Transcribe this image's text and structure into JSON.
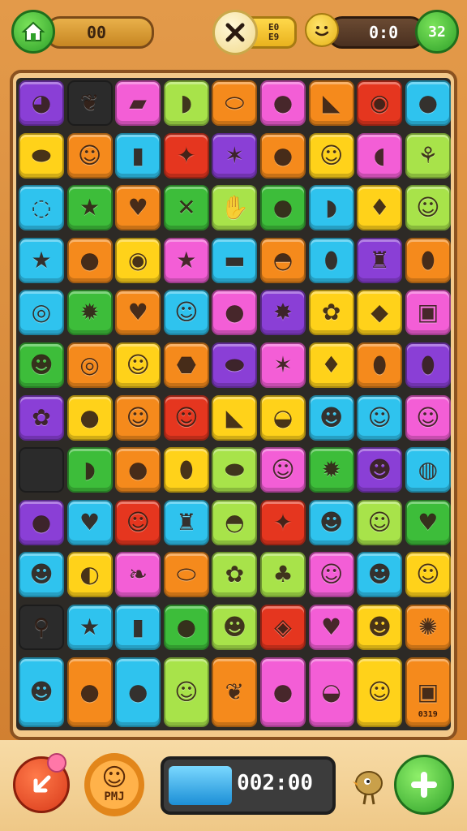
{
  "top_bar": {
    "home_icon": "house-icon",
    "left_counter": "00",
    "close_icon": "close-x-icon",
    "mid_badge": "E0\nE9",
    "smiley_icon": "smiley-icon",
    "right_counter": "0:0",
    "score": "32"
  },
  "board": {
    "colors": {
      "purple": "#8a3fd6",
      "dark": "#2b2b2b",
      "pink": "#f35ed6",
      "lime": "#a8e34a",
      "orange": "#f58a1c",
      "red": "#e5361f",
      "cyan": "#2fc3ee",
      "yellow": "#ffd21a",
      "green": "#3dbd3a",
      "magenta": "#d94fd9"
    },
    "tiles": [
      {
        "row": 0,
        "col": 0,
        "color": "purple",
        "icon": "ghost-icon",
        "glyph": "◕"
      },
      {
        "row": 0,
        "col": 1,
        "color": "dark",
        "icon": "leaf-icon",
        "glyph": "❦"
      },
      {
        "row": 0,
        "col": 2,
        "color": "pink",
        "icon": "flag-icon",
        "glyph": "▰"
      },
      {
        "row": 0,
        "col": 3,
        "color": "lime",
        "icon": "banana-icon",
        "glyph": "◗"
      },
      {
        "row": 0,
        "col": 4,
        "color": "orange",
        "icon": "lemon-icon",
        "glyph": "⬭"
      },
      {
        "row": 0,
        "col": 5,
        "color": "pink",
        "icon": "grape-icon",
        "glyph": "●"
      },
      {
        "row": 0,
        "col": 6,
        "color": "orange",
        "icon": "shoe-icon",
        "glyph": "◣"
      },
      {
        "row": 0,
        "col": 7,
        "color": "red",
        "icon": "speech-bubble-icon",
        "glyph": "◉"
      },
      {
        "row": 0,
        "col": 8,
        "color": "cyan",
        "icon": "apple-icon",
        "glyph": "●"
      },
      {
        "row": 1,
        "col": 0,
        "color": "yellow",
        "icon": "blob-icon",
        "glyph": "⬬"
      },
      {
        "row": 1,
        "col": 1,
        "color": "orange",
        "icon": "cat-face-icon",
        "glyph": "☺"
      },
      {
        "row": 1,
        "col": 2,
        "color": "cyan",
        "icon": "box-icon",
        "glyph": "▮"
      },
      {
        "row": 1,
        "col": 3,
        "color": "red",
        "icon": "star-burst-icon",
        "glyph": "✦"
      },
      {
        "row": 1,
        "col": 4,
        "color": "purple",
        "icon": "leaf-icon",
        "glyph": "✶"
      },
      {
        "row": 1,
        "col": 5,
        "color": "orange",
        "icon": "orange-fruit-icon",
        "glyph": "●"
      },
      {
        "row": 1,
        "col": 6,
        "color": "yellow",
        "icon": "face-icon",
        "glyph": "☺"
      },
      {
        "row": 1,
        "col": 7,
        "color": "pink",
        "icon": "blob-icon",
        "glyph": "◖"
      },
      {
        "row": 1,
        "col": 8,
        "color": "lime",
        "icon": "tulip-icon",
        "glyph": "⚘"
      },
      {
        "row": 2,
        "col": 0,
        "color": "cyan",
        "icon": "ring-icon",
        "glyph": "◌"
      },
      {
        "row": 2,
        "col": 1,
        "color": "green",
        "icon": "star-icon",
        "glyph": "★"
      },
      {
        "row": 2,
        "col": 2,
        "color": "orange",
        "icon": "heart-face-icon",
        "glyph": "♥"
      },
      {
        "row": 2,
        "col": 3,
        "color": "green",
        "icon": "fish-icon",
        "glyph": "✕"
      },
      {
        "row": 2,
        "col": 4,
        "color": "lime",
        "icon": "hand-icon",
        "glyph": "✋"
      },
      {
        "row": 2,
        "col": 5,
        "color": "green",
        "icon": "melon-icon",
        "glyph": "●"
      },
      {
        "row": 2,
        "col": 6,
        "color": "cyan",
        "icon": "eggplant-icon",
        "glyph": "◗"
      },
      {
        "row": 2,
        "col": 7,
        "color": "yellow",
        "icon": "strawberry-icon",
        "glyph": "♦"
      },
      {
        "row": 2,
        "col": 8,
        "color": "lime",
        "icon": "monster-face-icon",
        "glyph": "☺"
      },
      {
        "row": 3,
        "col": 0,
        "color": "cyan",
        "icon": "star-icon",
        "glyph": "★"
      },
      {
        "row": 3,
        "col": 1,
        "color": "orange",
        "icon": "apple-icon",
        "glyph": "●"
      },
      {
        "row": 3,
        "col": 2,
        "color": "yellow",
        "icon": "eye-icon",
        "glyph": "◉"
      },
      {
        "row": 3,
        "col": 3,
        "color": "pink",
        "icon": "star-icon",
        "glyph": "★"
      },
      {
        "row": 3,
        "col": 4,
        "color": "cyan",
        "icon": "flag-icon",
        "glyph": "▬"
      },
      {
        "row": 3,
        "col": 5,
        "color": "orange",
        "icon": "shell-icon",
        "glyph": "◓"
      },
      {
        "row": 3,
        "col": 6,
        "color": "cyan",
        "icon": "leaf-icon",
        "glyph": "⬮"
      },
      {
        "row": 3,
        "col": 7,
        "color": "purple",
        "icon": "bottle-icon",
        "glyph": "♜"
      },
      {
        "row": 3,
        "col": 8,
        "color": "orange",
        "icon": "pepper-icon",
        "glyph": "⬮"
      },
      {
        "row": 4,
        "col": 0,
        "color": "cyan",
        "icon": "swirl-icon",
        "glyph": "◎"
      },
      {
        "row": 4,
        "col": 1,
        "color": "green",
        "icon": "beetle-icon",
        "glyph": "✹"
      },
      {
        "row": 4,
        "col": 2,
        "color": "orange",
        "icon": "heart-icon",
        "glyph": "♥"
      },
      {
        "row": 4,
        "col": 3,
        "color": "cyan",
        "icon": "face-icon",
        "glyph": "☺"
      },
      {
        "row": 4,
        "col": 4,
        "color": "pink",
        "icon": "apple-icon",
        "glyph": "●"
      },
      {
        "row": 4,
        "col": 5,
        "color": "purple",
        "icon": "sparkle-icon",
        "glyph": "✸"
      },
      {
        "row": 4,
        "col": 6,
        "color": "yellow",
        "icon": "berry-icon",
        "glyph": "✿"
      },
      {
        "row": 4,
        "col": 7,
        "color": "yellow",
        "icon": "rock-icon",
        "glyph": "◆"
      },
      {
        "row": 4,
        "col": 8,
        "color": "pink",
        "icon": "robot-icon",
        "glyph": "▣"
      },
      {
        "row": 5,
        "col": 0,
        "color": "green",
        "icon": "blob-face-icon",
        "glyph": "☻"
      },
      {
        "row": 5,
        "col": 1,
        "color": "orange",
        "icon": "ring-icon",
        "glyph": "◎"
      },
      {
        "row": 5,
        "col": 2,
        "color": "yellow",
        "icon": "elf-face-icon",
        "glyph": "☺"
      },
      {
        "row": 5,
        "col": 3,
        "color": "orange",
        "icon": "blob-icon",
        "glyph": "⬣"
      },
      {
        "row": 5,
        "col": 4,
        "color": "purple",
        "icon": "drop-icon",
        "glyph": "⬬"
      },
      {
        "row": 5,
        "col": 5,
        "color": "pink",
        "icon": "star-icon",
        "glyph": "✶"
      },
      {
        "row": 5,
        "col": 6,
        "color": "yellow",
        "icon": "berry-icon",
        "glyph": "♦"
      },
      {
        "row": 5,
        "col": 7,
        "color": "orange",
        "icon": "leaf-icon",
        "glyph": "⬮"
      },
      {
        "row": 5,
        "col": 8,
        "color": "purple",
        "icon": "leaf-icon",
        "glyph": "⬮"
      },
      {
        "row": 6,
        "col": 0,
        "color": "purple",
        "icon": "candy-icon",
        "glyph": "✿"
      },
      {
        "row": 6,
        "col": 1,
        "color": "yellow",
        "icon": "apple-icon",
        "glyph": "●"
      },
      {
        "row": 6,
        "col": 2,
        "color": "orange",
        "icon": "pineapple-icon",
        "glyph": "☺"
      },
      {
        "row": 6,
        "col": 3,
        "color": "red",
        "icon": "face-icon",
        "glyph": "☺"
      },
      {
        "row": 6,
        "col": 4,
        "color": "yellow",
        "icon": "watermelon-icon",
        "glyph": "◣"
      },
      {
        "row": 6,
        "col": 5,
        "color": "yellow",
        "icon": "ball-icon",
        "glyph": "◒"
      },
      {
        "row": 6,
        "col": 6,
        "color": "cyan",
        "icon": "plum-face-icon",
        "glyph": "☻"
      },
      {
        "row": 6,
        "col": 7,
        "color": "cyan",
        "icon": "face-icon",
        "glyph": "☺"
      },
      {
        "row": 6,
        "col": 8,
        "color": "pink",
        "icon": "princess-face-icon",
        "glyph": "☺"
      },
      {
        "row": 7,
        "col": 0,
        "color": "dark",
        "icon": "empty-icon",
        "glyph": ""
      },
      {
        "row": 7,
        "col": 1,
        "color": "green",
        "icon": "carrot-icon",
        "glyph": "◗"
      },
      {
        "row": 7,
        "col": 2,
        "color": "orange",
        "icon": "plum-icon",
        "glyph": "●"
      },
      {
        "row": 7,
        "col": 3,
        "color": "yellow",
        "icon": "leaf-icon",
        "glyph": "⬮"
      },
      {
        "row": 7,
        "col": 4,
        "color": "lime",
        "icon": "lemon-icon",
        "glyph": "⬬"
      },
      {
        "row": 7,
        "col": 5,
        "color": "pink",
        "icon": "ghost-icon",
        "glyph": "☺"
      },
      {
        "row": 7,
        "col": 6,
        "color": "green",
        "icon": "sun-face-icon",
        "glyph": "✹"
      },
      {
        "row": 7,
        "col": 7,
        "color": "purple",
        "icon": "berry-face-icon",
        "glyph": "☻"
      },
      {
        "row": 7,
        "col": 8,
        "color": "cyan",
        "icon": "speech-bubble-icon",
        "glyph": "◍"
      },
      {
        "row": 8,
        "col": 0,
        "color": "purple",
        "icon": "pearl-icon",
        "glyph": "●"
      },
      {
        "row": 8,
        "col": 1,
        "color": "cyan",
        "icon": "heart-bubble-icon",
        "glyph": "♥"
      },
      {
        "row": 8,
        "col": 2,
        "color": "red",
        "icon": "panda-face-icon",
        "glyph": "☺"
      },
      {
        "row": 8,
        "col": 3,
        "color": "cyan",
        "icon": "bottle-icon",
        "glyph": "♜"
      },
      {
        "row": 8,
        "col": 4,
        "color": "lime",
        "icon": "lips-icon",
        "glyph": "◓"
      },
      {
        "row": 8,
        "col": 5,
        "color": "red",
        "icon": "star-icon",
        "glyph": "✦"
      },
      {
        "row": 8,
        "col": 6,
        "color": "cyan",
        "icon": "strawberry-face-icon",
        "glyph": "☻"
      },
      {
        "row": 8,
        "col": 7,
        "color": "lime",
        "icon": "frog-face-icon",
        "glyph": "☺"
      },
      {
        "row": 8,
        "col": 8,
        "color": "green",
        "icon": "heart-icon",
        "glyph": "♥"
      },
      {
        "row": 9,
        "col": 0,
        "color": "cyan",
        "icon": "face-icon",
        "glyph": "☻"
      },
      {
        "row": 9,
        "col": 1,
        "color": "yellow",
        "icon": "watermelon-icon",
        "glyph": "◐"
      },
      {
        "row": 9,
        "col": 2,
        "color": "pink",
        "icon": "leaf-icon",
        "glyph": "❧"
      },
      {
        "row": 9,
        "col": 3,
        "color": "orange",
        "icon": "pumpkin-icon",
        "glyph": "⬭"
      },
      {
        "row": 9,
        "col": 4,
        "color": "lime",
        "icon": "flower-icon",
        "glyph": "✿"
      },
      {
        "row": 9,
        "col": 5,
        "color": "lime",
        "icon": "broccoli-icon",
        "glyph": "♣"
      },
      {
        "row": 9,
        "col": 6,
        "color": "pink",
        "icon": "ghost-face-icon",
        "glyph": "☺"
      },
      {
        "row": 9,
        "col": 7,
        "color": "cyan",
        "icon": "acorn-face-icon",
        "glyph": "☻"
      },
      {
        "row": 9,
        "col": 8,
        "color": "yellow",
        "icon": "face-icon",
        "glyph": "☺"
      },
      {
        "row": 10,
        "col": 0,
        "color": "dark",
        "icon": "lollipop-icon",
        "glyph": "⚲"
      },
      {
        "row": 10,
        "col": 1,
        "color": "cyan",
        "icon": "star-face-icon",
        "glyph": "★"
      },
      {
        "row": 10,
        "col": 2,
        "color": "cyan",
        "icon": "pepper-icon",
        "glyph": "▮"
      },
      {
        "row": 10,
        "col": 3,
        "color": "green",
        "icon": "tomato-icon",
        "glyph": "●"
      },
      {
        "row": 10,
        "col": 4,
        "color": "lime",
        "icon": "blob-face-icon",
        "glyph": "☻"
      },
      {
        "row": 10,
        "col": 5,
        "color": "red",
        "icon": "box-icon",
        "glyph": "◈"
      },
      {
        "row": 10,
        "col": 6,
        "color": "pink",
        "icon": "heart-icon",
        "glyph": "♥"
      },
      {
        "row": 10,
        "col": 7,
        "color": "yellow",
        "icon": "lime-face-icon",
        "glyph": "☻"
      },
      {
        "row": 10,
        "col": 8,
        "color": "orange",
        "icon": "grass-icon",
        "glyph": "✺"
      },
      {
        "row": 11,
        "col": 0,
        "color": "cyan",
        "icon": "face-icon",
        "glyph": "☻",
        "tall": true
      },
      {
        "row": 11,
        "col": 1,
        "color": "orange",
        "icon": "apple-icon",
        "glyph": "●",
        "tall": true
      },
      {
        "row": 11,
        "col": 2,
        "color": "cyan",
        "icon": "cherry-icon",
        "glyph": "●",
        "tall": true
      },
      {
        "row": 11,
        "col": 3,
        "color": "lime",
        "icon": "cake-face-icon",
        "glyph": "☺",
        "tall": true
      },
      {
        "row": 11,
        "col": 4,
        "color": "orange",
        "icon": "leaf-icon",
        "glyph": "❦",
        "tall": true
      },
      {
        "row": 11,
        "col": 5,
        "color": "pink",
        "icon": "grape-icon",
        "glyph": "●",
        "tall": true
      },
      {
        "row": 11,
        "col": 6,
        "color": "pink",
        "icon": "bowl-icon",
        "glyph": "◒",
        "tall": true
      },
      {
        "row": 11,
        "col": 7,
        "color": "yellow",
        "icon": "doll-icon",
        "glyph": "☺",
        "tall": true
      },
      {
        "row": 11,
        "col": 8,
        "color": "orange",
        "icon": "toaster-icon",
        "glyph": "▣",
        "tall": true,
        "caption": "0319"
      }
    ]
  },
  "bottom_bar": {
    "back_icon": "back-arrow-icon",
    "badge_label": "PMJ",
    "timer_text": "002:00",
    "timer_progress": 0.4,
    "creature_icon": "bird-creature-icon",
    "add_icon": "plus-icon"
  }
}
